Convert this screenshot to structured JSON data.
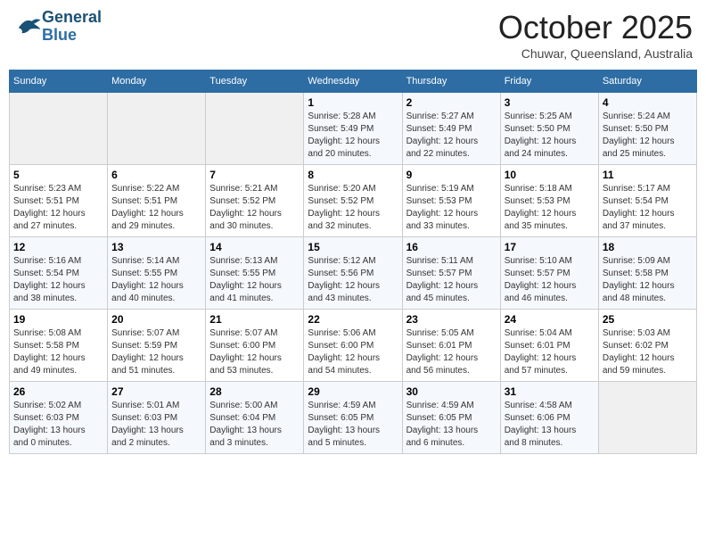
{
  "logo": {
    "line1": "General",
    "line2": "Blue"
  },
  "title": "October 2025",
  "location": "Chuwar, Queensland, Australia",
  "days_of_week": [
    "Sunday",
    "Monday",
    "Tuesday",
    "Wednesday",
    "Thursday",
    "Friday",
    "Saturday"
  ],
  "weeks": [
    [
      {
        "day": "",
        "detail": ""
      },
      {
        "day": "",
        "detail": ""
      },
      {
        "day": "",
        "detail": ""
      },
      {
        "day": "1",
        "detail": "Sunrise: 5:28 AM\nSunset: 5:49 PM\nDaylight: 12 hours\nand 20 minutes."
      },
      {
        "day": "2",
        "detail": "Sunrise: 5:27 AM\nSunset: 5:49 PM\nDaylight: 12 hours\nand 22 minutes."
      },
      {
        "day": "3",
        "detail": "Sunrise: 5:25 AM\nSunset: 5:50 PM\nDaylight: 12 hours\nand 24 minutes."
      },
      {
        "day": "4",
        "detail": "Sunrise: 5:24 AM\nSunset: 5:50 PM\nDaylight: 12 hours\nand 25 minutes."
      }
    ],
    [
      {
        "day": "5",
        "detail": "Sunrise: 5:23 AM\nSunset: 5:51 PM\nDaylight: 12 hours\nand 27 minutes."
      },
      {
        "day": "6",
        "detail": "Sunrise: 5:22 AM\nSunset: 5:51 PM\nDaylight: 12 hours\nand 29 minutes."
      },
      {
        "day": "7",
        "detail": "Sunrise: 5:21 AM\nSunset: 5:52 PM\nDaylight: 12 hours\nand 30 minutes."
      },
      {
        "day": "8",
        "detail": "Sunrise: 5:20 AM\nSunset: 5:52 PM\nDaylight: 12 hours\nand 32 minutes."
      },
      {
        "day": "9",
        "detail": "Sunrise: 5:19 AM\nSunset: 5:53 PM\nDaylight: 12 hours\nand 33 minutes."
      },
      {
        "day": "10",
        "detail": "Sunrise: 5:18 AM\nSunset: 5:53 PM\nDaylight: 12 hours\nand 35 minutes."
      },
      {
        "day": "11",
        "detail": "Sunrise: 5:17 AM\nSunset: 5:54 PM\nDaylight: 12 hours\nand 37 minutes."
      }
    ],
    [
      {
        "day": "12",
        "detail": "Sunrise: 5:16 AM\nSunset: 5:54 PM\nDaylight: 12 hours\nand 38 minutes."
      },
      {
        "day": "13",
        "detail": "Sunrise: 5:14 AM\nSunset: 5:55 PM\nDaylight: 12 hours\nand 40 minutes."
      },
      {
        "day": "14",
        "detail": "Sunrise: 5:13 AM\nSunset: 5:55 PM\nDaylight: 12 hours\nand 41 minutes."
      },
      {
        "day": "15",
        "detail": "Sunrise: 5:12 AM\nSunset: 5:56 PM\nDaylight: 12 hours\nand 43 minutes."
      },
      {
        "day": "16",
        "detail": "Sunrise: 5:11 AM\nSunset: 5:57 PM\nDaylight: 12 hours\nand 45 minutes."
      },
      {
        "day": "17",
        "detail": "Sunrise: 5:10 AM\nSunset: 5:57 PM\nDaylight: 12 hours\nand 46 minutes."
      },
      {
        "day": "18",
        "detail": "Sunrise: 5:09 AM\nSunset: 5:58 PM\nDaylight: 12 hours\nand 48 minutes."
      }
    ],
    [
      {
        "day": "19",
        "detail": "Sunrise: 5:08 AM\nSunset: 5:58 PM\nDaylight: 12 hours\nand 49 minutes."
      },
      {
        "day": "20",
        "detail": "Sunrise: 5:07 AM\nSunset: 5:59 PM\nDaylight: 12 hours\nand 51 minutes."
      },
      {
        "day": "21",
        "detail": "Sunrise: 5:07 AM\nSunset: 6:00 PM\nDaylight: 12 hours\nand 53 minutes."
      },
      {
        "day": "22",
        "detail": "Sunrise: 5:06 AM\nSunset: 6:00 PM\nDaylight: 12 hours\nand 54 minutes."
      },
      {
        "day": "23",
        "detail": "Sunrise: 5:05 AM\nSunset: 6:01 PM\nDaylight: 12 hours\nand 56 minutes."
      },
      {
        "day": "24",
        "detail": "Sunrise: 5:04 AM\nSunset: 6:01 PM\nDaylight: 12 hours\nand 57 minutes."
      },
      {
        "day": "25",
        "detail": "Sunrise: 5:03 AM\nSunset: 6:02 PM\nDaylight: 12 hours\nand 59 minutes."
      }
    ],
    [
      {
        "day": "26",
        "detail": "Sunrise: 5:02 AM\nSunset: 6:03 PM\nDaylight: 13 hours\nand 0 minutes."
      },
      {
        "day": "27",
        "detail": "Sunrise: 5:01 AM\nSunset: 6:03 PM\nDaylight: 13 hours\nand 2 minutes."
      },
      {
        "day": "28",
        "detail": "Sunrise: 5:00 AM\nSunset: 6:04 PM\nDaylight: 13 hours\nand 3 minutes."
      },
      {
        "day": "29",
        "detail": "Sunrise: 4:59 AM\nSunset: 6:05 PM\nDaylight: 13 hours\nand 5 minutes."
      },
      {
        "day": "30",
        "detail": "Sunrise: 4:59 AM\nSunset: 6:05 PM\nDaylight: 13 hours\nand 6 minutes."
      },
      {
        "day": "31",
        "detail": "Sunrise: 4:58 AM\nSunset: 6:06 PM\nDaylight: 13 hours\nand 8 minutes."
      },
      {
        "day": "",
        "detail": ""
      }
    ]
  ]
}
